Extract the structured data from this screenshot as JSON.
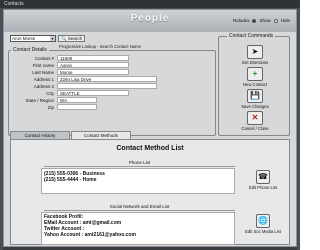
{
  "window": {
    "title": "Contacts"
  },
  "header": {
    "title": "People",
    "rolodex_label": "Rolodex",
    "show_label": "Show",
    "hide_label": "Hide"
  },
  "search": {
    "selected": "Aron Morse",
    "button_label": "Search",
    "lookup_text": "Progressive Lookup - Search Contact Name"
  },
  "contact_details": {
    "title": "Contact Details",
    "fields": [
      {
        "label": "Contact #",
        "value": "11609"
      },
      {
        "label": "First name",
        "value": "Aaron"
      },
      {
        "label": "Last Name",
        "value": "Morse"
      },
      {
        "label": "Address 1",
        "value": "2294 Lisa Drive"
      },
      {
        "label": "Address 2",
        "value": ""
      },
      {
        "label": "City",
        "value": "SEATTLE"
      },
      {
        "label": "State / Region",
        "value": "WA"
      },
      {
        "label": "Zip",
        "value": ""
      }
    ]
  },
  "commands": {
    "title": "Contact Commands",
    "items": [
      {
        "label": "Get Directions",
        "icon": "map-icon"
      },
      {
        "label": "New Contact",
        "icon": "add-icon"
      },
      {
        "label": "Save Changes",
        "icon": "save-icon"
      },
      {
        "label": "Cancel / Close",
        "icon": "close-icon"
      }
    ]
  },
  "tabs": [
    {
      "label": "Contact History"
    },
    {
      "label": "Contact Methods"
    }
  ],
  "contact_methods": {
    "title": "Contact Method List",
    "phone_section": "Phone List",
    "phones": [
      "(215) 555-0306 - Business",
      "(215) 555-4444 - Home"
    ],
    "edit_phone_label": "Edit Phone List",
    "social_section": "Social Network and Email List",
    "social": [
      "Facebook Profil:",
      "EMail Account  : amt@gmail.com",
      "Twitter Account :",
      "Yahoo Account  : amt2161@yahoo.com"
    ],
    "edit_social_label": "Edit Soc Media List"
  },
  "status": {
    "left": "",
    "right": ""
  }
}
